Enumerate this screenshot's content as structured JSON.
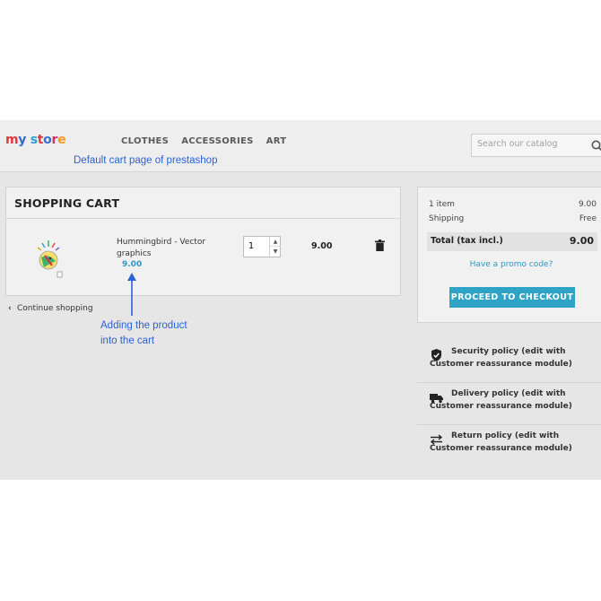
{
  "store": {
    "logo_letters": [
      "m",
      "y",
      " ",
      "s",
      "t",
      "o",
      "r",
      "e"
    ],
    "logo_colors": [
      "#e03a3a",
      "#2c6bd4",
      "#ffffff",
      "#2c9fd4",
      "#e03a3a",
      "#3b6fd1",
      "#d72f6b",
      "#f29a1f"
    ]
  },
  "nav": [
    "CLOTHES",
    "ACCESSORIES",
    "ART"
  ],
  "search": {
    "placeholder": "Search our catalog"
  },
  "annotations": {
    "top": "Default cart page of prestashop",
    "bottom_line1": "Adding the product",
    "bottom_line2": "into the cart"
  },
  "cart": {
    "title": "SHOPPING CART",
    "item": {
      "name": "Hummingbird - Vector graphics",
      "price": "9.00",
      "quantity": "1",
      "line_total": "9.00"
    },
    "continue_label": "Continue shopping"
  },
  "summary": {
    "items_label": "1 item",
    "items_value": "9.00",
    "shipping_label": "Shipping",
    "shipping_value": "Free",
    "total_label": "Total (tax incl.)",
    "total_value": "9.00",
    "promo_label": "Have a promo code?",
    "checkout_label": "PROCEED TO CHECKOUT"
  },
  "reassurance": [
    {
      "icon": "shield-icon",
      "text": "Security policy (edit with Customer reassurance module)"
    },
    {
      "icon": "truck-icon",
      "text": "Delivery policy (edit with Customer reassurance module)"
    },
    {
      "icon": "swap-arrows-icon",
      "text": "Return policy (edit with Customer reassurance module)"
    }
  ],
  "colors": {
    "accent": "#2fa3c6",
    "annotation": "#2a63d6",
    "background": "#e6e6e6"
  }
}
